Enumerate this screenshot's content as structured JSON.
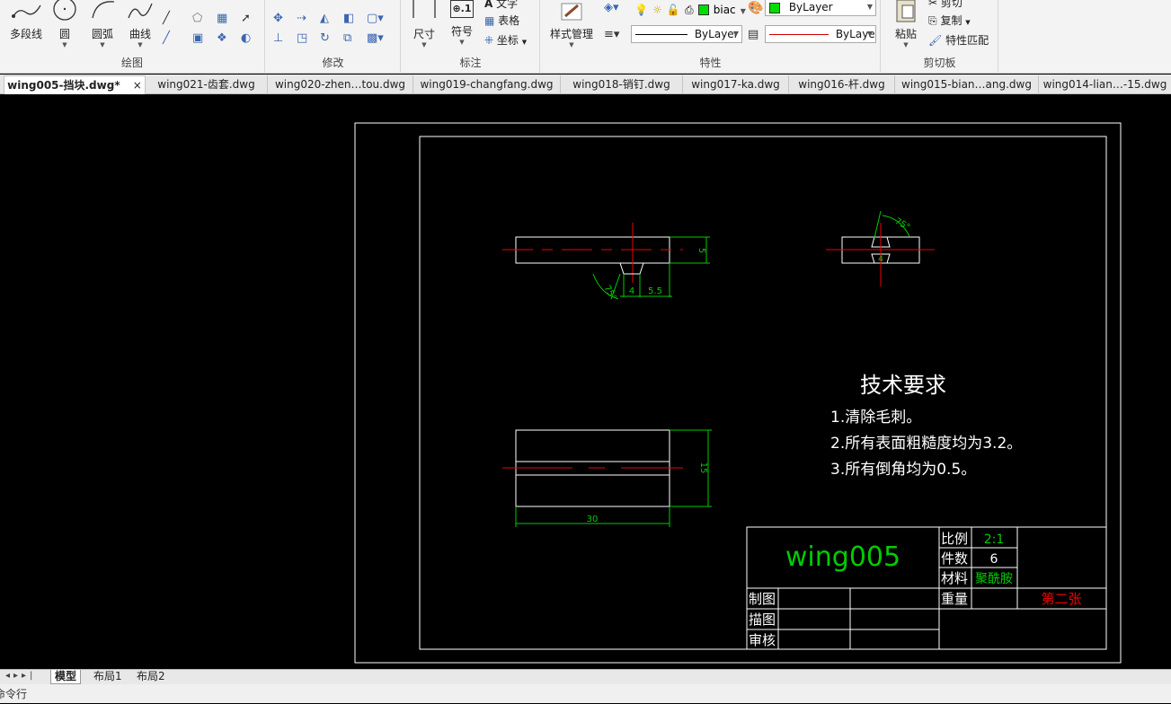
{
  "ribbon": {
    "draw": {
      "label": "绘图",
      "polyline": "多段线",
      "circle": "圆",
      "arc": "圆弧",
      "curve": "曲线"
    },
    "modify": {
      "label": "修改"
    },
    "annotate": {
      "label": "标注",
      "dimension": "尺寸",
      "symbol": "符号",
      "text": "文字",
      "table": "表格",
      "coordinate": "坐标"
    },
    "style_manage": "样式管理",
    "properties": {
      "label": "特性",
      "layer_name": "biac",
      "color_value": "ByLayer",
      "linetype_value": "ByLayer",
      "lineweight_value": "ByLaye"
    },
    "clipboard": {
      "label": "剪切板",
      "paste": "粘贴",
      "cut": "剪切",
      "copy": "复制",
      "match_properties": "特性匹配"
    }
  },
  "doc_tabs": [
    {
      "label": "wing005-挡块.dwg*",
      "active": true
    },
    {
      "label": "wing021-齿套.dwg",
      "active": false
    },
    {
      "label": "wing020-zhen…tou.dwg",
      "active": false
    },
    {
      "label": "wing019-changfang.dwg",
      "active": false
    },
    {
      "label": "wing018-销钉.dwg",
      "active": false
    },
    {
      "label": "wing017-ka.dwg",
      "active": false
    },
    {
      "label": "wing016-杆.dwg",
      "active": false
    },
    {
      "label": "wing015-bian…ang.dwg",
      "active": false
    },
    {
      "label": "wing014-lian…-15.dwg",
      "active": false
    }
  ],
  "drawing": {
    "dims": {
      "top_height": "5",
      "slot_width": "4",
      "offset": "5.5",
      "angle": "75°",
      "side_width": "4",
      "side_angle": "75°",
      "bottom_height": "15",
      "bottom_width": "30"
    },
    "tech_req": {
      "title": "技术要求",
      "items": [
        "1.清除毛刺。",
        "2.所有表面粗糙度均为3.2。",
        "3.所有倒角均为0.5。"
      ]
    },
    "title_block": {
      "name": "wing005",
      "scale_label": "比例",
      "scale_value": "2:1",
      "qty_label": "件数",
      "qty_value": "6",
      "material_label": "材料",
      "material_value": "聚酰胺",
      "weight_label": "重量",
      "sheet_value": "第二张",
      "drawn_label": "制图",
      "traced_label": "描图",
      "checked_label": "审核"
    }
  },
  "layout_tabs": [
    "模型",
    "布局1",
    "布局2"
  ],
  "command_line": "命令行"
}
